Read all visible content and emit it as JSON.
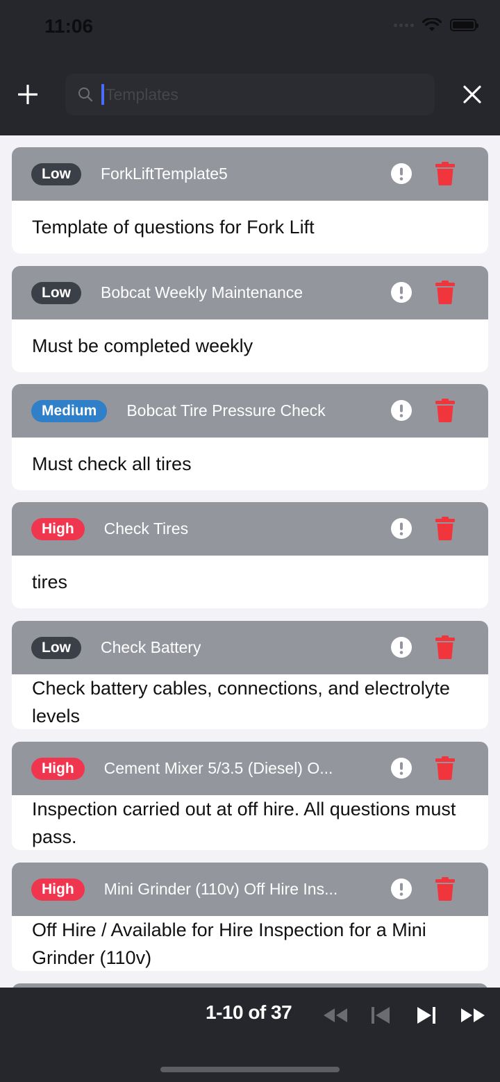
{
  "status_bar": {
    "time": "11:06"
  },
  "header": {
    "search_placeholder": "Templates",
    "search_value": ""
  },
  "templates": [
    {
      "priority": "Low",
      "priority_level": "low",
      "title": "ForkLiftTemplate5",
      "description": "Template of questions for Fork Lift"
    },
    {
      "priority": "Low",
      "priority_level": "low",
      "title": "Bobcat Weekly Maintenance",
      "description": "Must be completed weekly"
    },
    {
      "priority": "Medium",
      "priority_level": "medium",
      "title": "Bobcat Tire Pressure Check",
      "description": "Must check all tires"
    },
    {
      "priority": "High",
      "priority_level": "high",
      "title": "Check Tires",
      "description": "tires"
    },
    {
      "priority": "Low",
      "priority_level": "low",
      "title": "Check Battery",
      "description": "Check battery cables, connections, and electrolyte levels"
    },
    {
      "priority": "High",
      "priority_level": "high",
      "title": "Cement Mixer 5/3.5 (Diesel) O...",
      "description": "Inspection carried out at off hire. All questions must pass."
    },
    {
      "priority": "High",
      "priority_level": "high",
      "title": "Mini Grinder (110v) Off Hire Ins...",
      "description": "Off Hire / Available for Hire Inspection for a Mini Grinder (110v)"
    }
  ],
  "pagination": {
    "label": "1-10 of 37"
  },
  "colors": {
    "bar_background": "#26272c",
    "card_header": "#94969e",
    "priority_low": "#3b3f48",
    "priority_medium": "#2f80c8",
    "priority_high": "#f0364f",
    "delete_red": "#f0363c"
  }
}
